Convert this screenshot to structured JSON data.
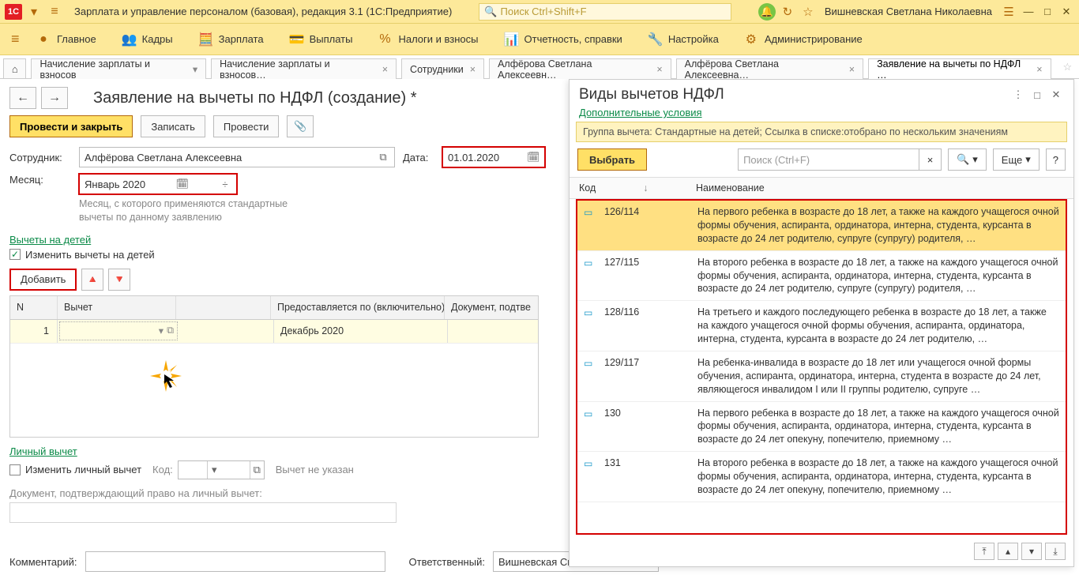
{
  "titlebar": {
    "logo": "1C",
    "title": "Зарплата и управление персоналом (базовая), редакция 3.1  (1С:Предприятие)",
    "search_placeholder": "Поиск Ctrl+Shift+F",
    "user": "Вишневская Светлана Николаевна"
  },
  "menu": {
    "items": [
      {
        "icon": "●",
        "label": "Главное"
      },
      {
        "icon": "👥",
        "label": "Кадры"
      },
      {
        "icon": "🧮",
        "label": "Зарплата"
      },
      {
        "icon": "💳",
        "label": "Выплаты"
      },
      {
        "icon": "%",
        "label": "Налоги и взносы"
      },
      {
        "icon": "📊",
        "label": "Отчетность, справки"
      },
      {
        "icon": "🔧",
        "label": "Настройка"
      },
      {
        "icon": "⚙",
        "label": "Администрирование"
      }
    ]
  },
  "tabs": {
    "items": [
      "Начисление зарплаты и взносов",
      "Начисление зарплаты и взносов…",
      "Сотрудники",
      "Алфёрова Светлана Алексеевн…",
      "Алфёрова Светлана Алексеевна…",
      "Заявление на вычеты по НДФЛ …"
    ]
  },
  "form": {
    "page_title": "Заявление на вычеты по НДФЛ (создание) *",
    "buttons": {
      "primary": "Провести и закрыть",
      "save": "Записать",
      "post": "Провести",
      "attach": "📎"
    },
    "employee_label": "Сотрудник:",
    "employee_value": "Алфёрова Светлана Алексеевна",
    "date_label": "Дата:",
    "date_value": "01.01.2020",
    "month_label": "Месяц:",
    "month_value": "Январь 2020",
    "month_hint": "Месяц, с которого применяются стандартные вычеты по данному заявлению",
    "sect_children": "Вычеты на детей",
    "chk_children": "Изменить вычеты на детей",
    "add_btn": "Добавить",
    "table": {
      "headers": {
        "n": "N",
        "v": "Вычет",
        "e": "",
        "p": "Предоставляется по (включительно)",
        "d": "Документ, подтве"
      },
      "row": {
        "n": "1",
        "v": "",
        "p": "Декабрь 2020"
      }
    },
    "sect_personal": "Личный вычет",
    "chk_personal": "Изменить личный вычет",
    "code_label": "Код:",
    "personal_not_set": "Вычет не указан",
    "doc_label": "Документ, подтверждающий право на личный вычет:",
    "comment_label": "Комментарий:",
    "resp_label": "Ответственный:",
    "resp_value": "Вишневская Светлана Ни"
  },
  "panel": {
    "title": "Виды вычетов НДФЛ",
    "sub": "Дополнительные условия",
    "filter": "Группа вычета: Стандартные на детей; Ссылка в списке:отобрано по нескольким значениям",
    "select_btn": "Выбрать",
    "search_placeholder": "Поиск (Ctrl+F)",
    "more_btn": "Еще",
    "col_code": "Код",
    "col_name": "Наименование",
    "rows": [
      {
        "code": "126/114",
        "desc": "На первого ребенка в возрасте до 18 лет, а также на каждого учащегося очной формы обучения, аспиранта, ординатора, интерна, студента, курсанта в возрасте до 24 лет родителю, супруге (супругу) родителя, …"
      },
      {
        "code": "127/115",
        "desc": "На второго ребенка в возрасте до 18 лет, а также на каждого учащегося очной формы обучения, аспиранта, ординатора, интерна, студента, курсанта в возрасте до 24 лет родителю, супруге (супругу) родителя, …"
      },
      {
        "code": "128/116",
        "desc": "На третьего и каждого последующего ребенка в возрасте до 18 лет, а также на каждого учащегося очной формы обучения, аспиранта, ординатора, интерна, студента, курсанта в возрасте до 24 лет родителю, …"
      },
      {
        "code": "129/117",
        "desc": "На ребенка-инвалида в возрасте до 18 лет или учащегося очной формы обучения, аспиранта, ординатора, интерна, студента в возрасте до 24 лет, являющегося инвалидом I или II группы родителю, супруге …"
      },
      {
        "code": "130",
        "desc": "На первого ребенка в возрасте до 18 лет, а также на каждого учащегося очной формы обучения, аспиранта, ординатора, интерна, студента, курсанта в возрасте до 24 лет опекуну, попечителю, приемному …"
      },
      {
        "code": "131",
        "desc": "На второго ребенка в возрасте до 18 лет, а также на каждого учащегося очной формы обучения, аспиранта, ординатора, интерна, студента, курсанта в возрасте до 24 лет опекуну, попечителю, приемному …"
      }
    ],
    "help": "?"
  }
}
